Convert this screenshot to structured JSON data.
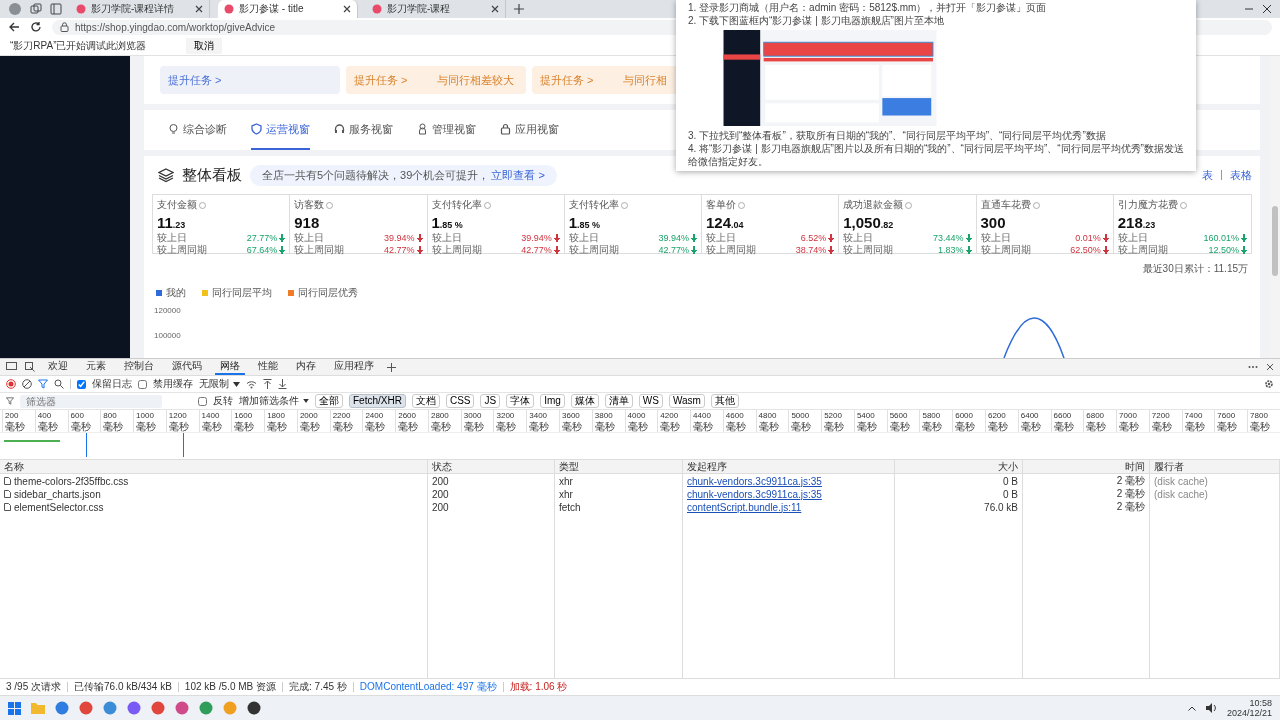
{
  "browser": {
    "tabs": [
      {
        "title": "影刀学院-课程详情",
        "selected": false
      },
      {
        "title": "影刀参谋 - title",
        "selected": true
      },
      {
        "title": "影刀学院-课程",
        "selected": false
      }
    ],
    "url": "https://shop.yingdao.com/worktop/giveAdvice",
    "infobar": {
      "message": "“影刀RPA”已开始调试此浏览器",
      "button": "取消"
    }
  },
  "page": {
    "task_cards": [
      {
        "kind": "neutral",
        "action": "提升任务 >"
      },
      {
        "kind": "warning",
        "action": "提升任务 >",
        "note": "与同行相差较大"
      },
      {
        "kind": "warning",
        "action": "提升任务 >",
        "note": "与同行相"
      }
    ],
    "view_tabs": [
      {
        "label": "综合诊断",
        "selected": false
      },
      {
        "label": "运营视窗",
        "selected": true
      },
      {
        "label": "服务视窗",
        "selected": false
      },
      {
        "label": "管理视窗",
        "selected": false
      },
      {
        "label": "应用视窗",
        "selected": false
      }
    ],
    "board": {
      "title": "整体看板",
      "notice": "全店一共有5个问题待解决，39个机会可提升，",
      "notice_link": "立即查看 >",
      "view_switch": [
        "表",
        "表格"
      ]
    },
    "metrics": [
      {
        "name": "支付金额",
        "value": "11",
        "fraction": ".23",
        "changes": [
          {
            "label": "较上日",
            "value": "27.77%",
            "color": "#1aa36b"
          },
          {
            "label": "较上周同期",
            "value": "67.64%",
            "color": "#1aa36b"
          }
        ]
      },
      {
        "name": "访客数",
        "value": "918",
        "changes": [
          {
            "label": "较上日",
            "value": "39.94%",
            "color": "#d0343f"
          },
          {
            "label": "较上周同期",
            "value": "42.77%",
            "color": "#d0343f"
          }
        ]
      },
      {
        "name": "支付转化率",
        "value": "1",
        "fraction": ".85 %",
        "changes": [
          {
            "label": "较上日",
            "value": "39.94%",
            "color": "#d0343f"
          },
          {
            "label": "较上周同期",
            "value": "42.77%",
            "color": "#d0343f"
          }
        ]
      },
      {
        "name": "支付转化率",
        "value": "1",
        "fraction": ".85 %",
        "changes": [
          {
            "label": "较上日",
            "value": "39.94%",
            "color": "#1aa36b"
          },
          {
            "label": "较上周同期",
            "value": "42.77%",
            "color": "#1aa36b"
          }
        ]
      },
      {
        "name": "客单价",
        "value": "124",
        "fraction": ".04",
        "changes": [
          {
            "label": "较上日",
            "value": "6.52%",
            "color": "#d0343f"
          },
          {
            "label": "较上周同期",
            "value": "38.74%",
            "color": "#d0343f"
          }
        ]
      },
      {
        "name": "成功退款金额",
        "value": "1,050",
        "fraction": ".82",
        "changes": [
          {
            "label": "较上日",
            "value": "73.44%",
            "color": "#1aa36b"
          },
          {
            "label": "较上周同期",
            "value": "1.83%",
            "color": "#1aa36b"
          }
        ]
      },
      {
        "name": "直通车花费",
        "value": "300",
        "changes": [
          {
            "label": "较上日",
            "value": "0.01%",
            "color": "#d0343f"
          },
          {
            "label": "较上周同期",
            "value": "62.50%",
            "color": "#d0343f"
          }
        ]
      },
      {
        "name": "引力魔方花费",
        "value": "218",
        "fraction": ".23",
        "changes": [
          {
            "label": "较上日",
            "value": "160.01%",
            "color": "#1aa36b"
          },
          {
            "label": "较上周同期",
            "value": "12.50%",
            "color": "#1aa36b"
          }
        ]
      }
    ],
    "cumulative": "最近30日累计：11.15万",
    "legend": [
      {
        "name": "我的",
        "color": "#2f6bd8"
      },
      {
        "name": "同行同层平均",
        "color": "#f2c21b"
      },
      {
        "name": "同行同层优秀",
        "color": "#f07c2a"
      }
    ],
    "y_ticks": [
      "120000",
      "100000"
    ]
  },
  "doc": {
    "steps": [
      "1. 登录影刀商城（用户名：admin 密码：5812$.mm），并打开「影刀参谋」页面",
      "2. 下载下图蓝框内“影刀参谋 | 影刀电器旗舰店”图片至本地",
      "3. 下拉找到“整体看板”，获取所有日期的“我的”、“同行同层平均平均”、“同行同层平均优秀”数据",
      "4. 将“影刀参谋 | 影刀电器旗舰店”图片以及所有日期的“我的”、“同行同层平均平均”、“同行同层平均优秀”数据发送给微信指定好友。"
    ]
  },
  "devtools": {
    "tabs": [
      {
        "label": "欢迎",
        "selected": false
      },
      {
        "label": "元素",
        "selected": false
      },
      {
        "label": "控制台",
        "selected": false
      },
      {
        "label": "源代码",
        "selected": false
      },
      {
        "label": "网络",
        "selected": true
      },
      {
        "label": "性能",
        "selected": false
      },
      {
        "label": "内存",
        "selected": false
      },
      {
        "label": "应用程序",
        "selected": false
      }
    ],
    "preserve_log": {
      "label": "保留日志",
      "checked": true
    },
    "disable_cache": {
      "label": "禁用缓存",
      "checked": false
    },
    "throttle": "无限制",
    "filter": {
      "placeholder": "筛选器"
    },
    "invert": {
      "label": "反转",
      "checked": false
    },
    "more_filters": "增加筛选条件",
    "type_filters": [
      {
        "label": "全部",
        "selected": false
      },
      {
        "label": "Fetch/XHR",
        "selected": true
      },
      {
        "label": "文档",
        "selected": false
      },
      {
        "label": "CSS",
        "selected": false
      },
      {
        "label": "JS",
        "selected": false
      },
      {
        "label": "字体",
        "selected": false
      },
      {
        "label": "Img",
        "selected": false
      },
      {
        "label": "媒体",
        "selected": false
      },
      {
        "label": "清单",
        "selected": false
      },
      {
        "label": "WS",
        "selected": false
      },
      {
        "label": "Wasm",
        "selected": false
      },
      {
        "label": "其他",
        "selected": false
      }
    ],
    "timeline_ticks": [
      {
        "value": "200",
        "unit": "毫秒"
      },
      {
        "value": "400",
        "unit": "毫秒"
      },
      {
        "value": "600",
        "unit": "毫秒"
      },
      {
        "value": "800",
        "unit": "毫秒"
      },
      {
        "value": "1000",
        "unit": "毫秒"
      },
      {
        "value": "1200",
        "unit": "毫秒"
      },
      {
        "value": "1400",
        "unit": "毫秒"
      },
      {
        "value": "1600",
        "unit": "毫秒"
      },
      {
        "value": "1800",
        "unit": "毫秒"
      },
      {
        "value": "2000",
        "unit": "毫秒"
      },
      {
        "value": "2200",
        "unit": "毫秒"
      },
      {
        "value": "2400",
        "unit": "毫秒"
      },
      {
        "value": "2600",
        "unit": "毫秒"
      },
      {
        "value": "2800",
        "unit": "毫秒"
      },
      {
        "value": "3000",
        "unit": "毫秒"
      },
      {
        "value": "3200",
        "unit": "毫秒"
      },
      {
        "value": "3400",
        "unit": "毫秒"
      },
      {
        "value": "3600",
        "unit": "毫秒"
      },
      {
        "value": "3800",
        "unit": "毫秒"
      },
      {
        "value": "4000",
        "unit": "毫秒"
      },
      {
        "value": "4200",
        "unit": "毫秒"
      },
      {
        "value": "4400",
        "unit": "毫秒"
      },
      {
        "value": "4600",
        "unit": "毫秒"
      },
      {
        "value": "4800",
        "unit": "毫秒"
      },
      {
        "value": "5000",
        "unit": "毫秒"
      },
      {
        "value": "5200",
        "unit": "毫秒"
      },
      {
        "value": "5400",
        "unit": "毫秒"
      },
      {
        "value": "5600",
        "unit": "毫秒"
      },
      {
        "value": "5800",
        "unit": "毫秒"
      },
      {
        "value": "6000",
        "unit": "毫秒"
      },
      {
        "value": "6200",
        "unit": "毫秒"
      },
      {
        "value": "6400",
        "unit": "毫秒"
      },
      {
        "value": "6600",
        "unit": "毫秒"
      },
      {
        "value": "6800",
        "unit": "毫秒"
      },
      {
        "value": "7000",
        "unit": "毫秒"
      },
      {
        "value": "7200",
        "unit": "毫秒"
      },
      {
        "value": "7400",
        "unit": "毫秒"
      },
      {
        "value": "7600",
        "unit": "毫秒"
      },
      {
        "value": "7800",
        "unit": "毫秒"
      }
    ],
    "columns": [
      "名称",
      "状态",
      "类型",
      "发起程序",
      "大小",
      "时间",
      "履行者"
    ],
    "rows": [
      {
        "name": "theme-colors-2f35ffbc.css",
        "status": "200",
        "type": "xhr",
        "initiator": "chunk-vendors.3c9911ca.js:35",
        "size": "0 B",
        "time": "2 毫秒",
        "fulfilled_by": "(disk cache)"
      },
      {
        "name": "sidebar_charts.json",
        "status": "200",
        "type": "xhr",
        "initiator": "chunk-vendors.3c9911ca.js:35",
        "size": "0 B",
        "time": "2 毫秒",
        "fulfilled_by": "(disk cache)"
      },
      {
        "name": "elementSelector.css",
        "status": "200",
        "type": "fetch",
        "initiator": "contentScript.bundle.js:11",
        "size": "76.0 kB",
        "time": "2 毫秒"
      }
    ],
    "status": {
      "requests": "3 /95 次请求",
      "transferred": "已传输76.0 kB/434 kB",
      "resources": "102 kB /5.0 MB 资源",
      "finish": "完成: 7.45 秒",
      "dcl": "DOMContentLoaded: 497 毫秒",
      "load": "加载: 1.06 秒"
    }
  },
  "taskbar": {
    "time": "10:58",
    "date": "2024/12/21"
  }
}
